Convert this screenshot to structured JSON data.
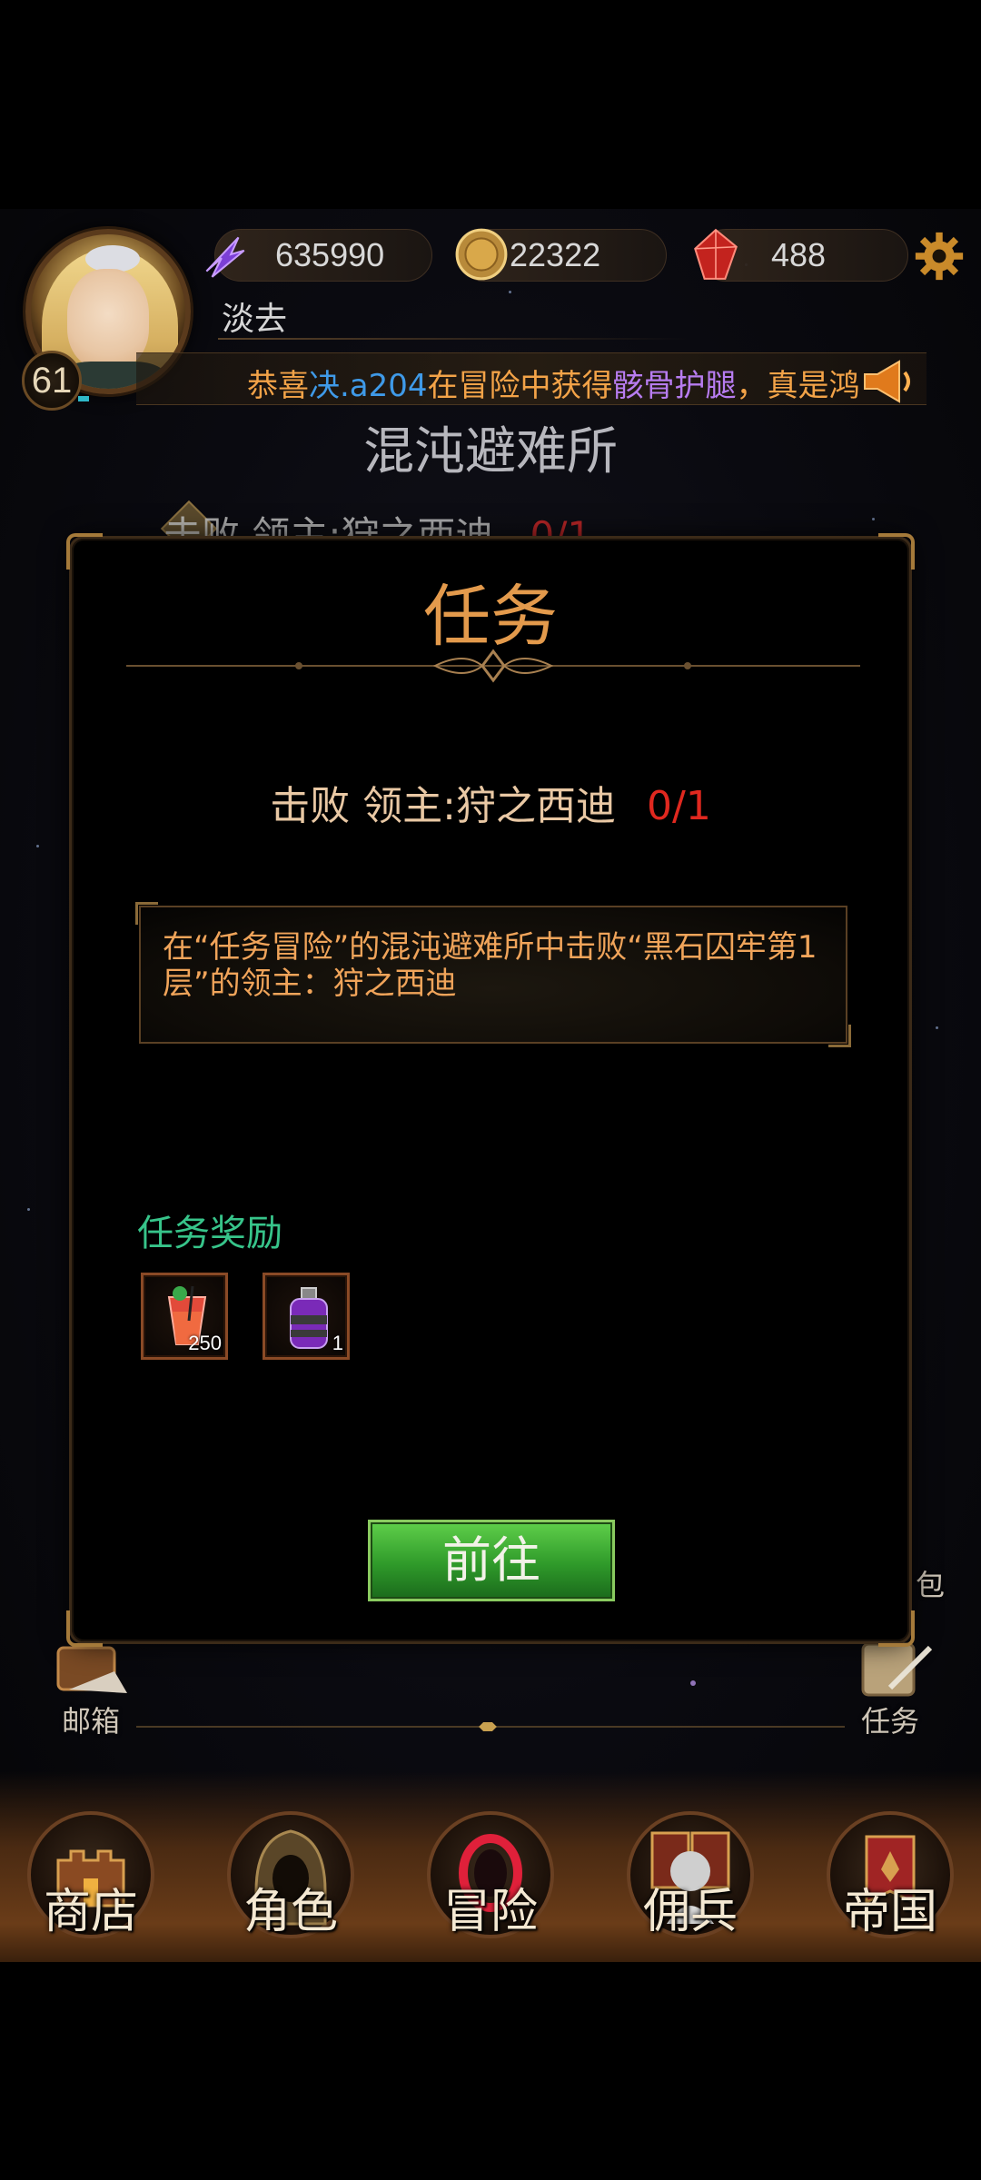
{
  "player": {
    "name": "淡去",
    "level": "61"
  },
  "resources": {
    "power": "635990",
    "gold": "22322",
    "gems": "488"
  },
  "news": {
    "part1": "恭喜",
    "player": "决.a204",
    "part2": "在冒险中获得",
    "item": "骸骨护腿",
    "part3": "，真是鸿"
  },
  "area": {
    "title": "混沌避难所",
    "bg_quest": "击败 领主:狩之西迪",
    "bg_quest_count": "0/1"
  },
  "modal": {
    "title": "任务",
    "quest_name": "击败  领主:狩之西迪",
    "quest_count": "0/1",
    "description": "在“任务冒险”的混沌避难所中击败“黑石囚牢第1层”的领主：狩之西迪",
    "reward_label": "任务奖励",
    "rewards": [
      {
        "icon": "cocktail-icon",
        "qty": "250"
      },
      {
        "icon": "potion-bottle-icon",
        "qty": "1"
      }
    ],
    "go_button": "前往"
  },
  "side": {
    "mailbox": "邮箱",
    "quest": "任务",
    "bag_partial": "包"
  },
  "nav": {
    "shop": "商店",
    "character": "角色",
    "adventure": "冒险",
    "mercenary": "佣兵",
    "empire": "帝国"
  },
  "colors": {
    "accent_orange": "#e39a4c",
    "count_red": "#e0281f",
    "reward_green": "#37c48a",
    "button_green": "#2f9a2a"
  }
}
